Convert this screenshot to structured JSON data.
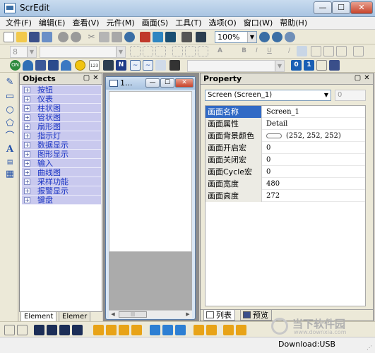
{
  "window": {
    "title": "ScrEdit",
    "min_glyph": "—",
    "max_glyph": "☐",
    "close_glyph": "✕"
  },
  "menu": [
    "文件(F)",
    "编辑(E)",
    "查看(V)",
    "元件(M)",
    "画面(S)",
    "工具(T)",
    "选项(O)",
    "窗口(W)",
    "帮助(H)"
  ],
  "toolbar1": {
    "zoom_value": "100%",
    "icons": [
      "new-file-icon",
      "open-folder-icon",
      "save-icon",
      "import-icon",
      "undo-icon",
      "redo-icon",
      "cut-icon",
      "copy-icon",
      "paste-icon",
      "find-icon",
      "compile-icon",
      "download-icon",
      "simulate-icon",
      "print-icon",
      "toolbox-icon",
      "zoom-in-icon",
      "zoom-out-icon",
      "zoom-fit-icon"
    ]
  },
  "toolbar2": {
    "font_size_value": "8",
    "font_name_value": "",
    "format_icons": [
      "align-left-icon",
      "align-center-icon",
      "align-right-icon",
      "align-top-icon",
      "align-middle-icon",
      "align-bottom-icon",
      "font-color-icon",
      "bold-icon",
      "italic-icon",
      "underline-icon",
      "pen-icon",
      "fill-icon",
      "layer-icon",
      "group-icon",
      "ungroup-icon",
      "lock-icon"
    ]
  },
  "toolbar3": {
    "style_value": "",
    "element_icons": [
      "switch-element-icon",
      "meter-element-icon",
      "lamp-element-icon",
      "pipe-element-icon",
      "dome-element-icon",
      "round-button-icon",
      "number-display-icon",
      "keypad-icon",
      "nixie-icon",
      "trend-icon",
      "alarm-icon",
      "keyboard-icon",
      "rotate-icon",
      "digit-0-icon",
      "digit-1-icon",
      "grid-icon",
      "save-small-icon"
    ],
    "nixie_label": "123",
    "digit0": "0",
    "digit1": "1"
  },
  "left_tools": [
    "pencil-icon",
    "rectangle-icon",
    "circle-icon",
    "polygon-icon",
    "arc-icon",
    "text-icon",
    "ruler-icon",
    "table-icon"
  ],
  "objects_panel": {
    "title": "Objects",
    "items": [
      "按钮",
      "仪表",
      "柱状图",
      "管状图",
      "扇形图",
      "指示灯",
      "数据显示",
      "图形显示",
      "输入",
      "曲线图",
      "采样功能",
      "报警显示",
      "键盘"
    ],
    "plus_glyph": "+",
    "tabs": [
      "Element",
      "Elemer"
    ]
  },
  "document": {
    "title": "1..."
  },
  "property_panel": {
    "title": "Property",
    "object_selector": "Screen (Screen_1)",
    "spin_value": "0",
    "rows": [
      {
        "key": "画面名称",
        "value": "Screen_1"
      },
      {
        "key": "画面属性",
        "value": "Detail"
      },
      {
        "key": "画面背景颜色",
        "value": "(252, 252, 252)"
      },
      {
        "key": "画面开启宏",
        "value": "0"
      },
      {
        "key": "画面关闭宏",
        "value": "0"
      },
      {
        "key": "画面Cycle宏",
        "value": "0"
      },
      {
        "key": "画面宽度",
        "value": "480"
      },
      {
        "key": "画面高度",
        "value": "272"
      }
    ],
    "bg_color": "#fcfcfc",
    "tabs": [
      "列表",
      "预览"
    ]
  },
  "bottom_toolbar": {
    "icons": [
      "bring-front-icon",
      "send-back-icon",
      "forward-icon",
      "backward-icon",
      "align-l-icon",
      "align-c-icon",
      "align-r-icon",
      "align-t-icon",
      "align-m-icon",
      "align-b-icon",
      "same-width-icon",
      "same-height-icon",
      "same-size-icon",
      "space-h-icon",
      "space-v-icon",
      "center-icon"
    ]
  },
  "status": {
    "download": "Download:USB"
  },
  "watermark": {
    "text": "当下软件园",
    "sub": "www.downxia.com"
  },
  "colors": {
    "accent": "#316ac5",
    "object_item_bg": "#c9c9ee",
    "object_item_text": "#1b35c4"
  }
}
